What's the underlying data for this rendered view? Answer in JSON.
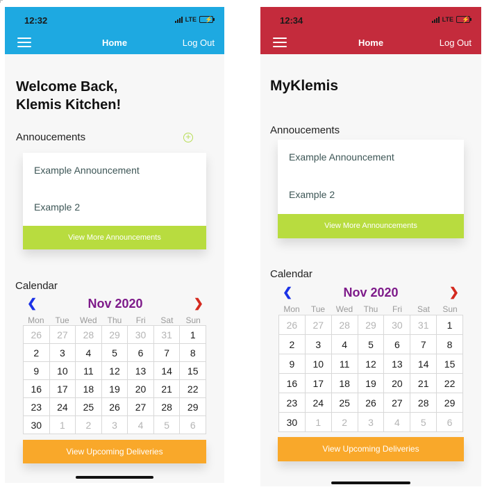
{
  "left_screen": {
    "status": {
      "time": "12:32",
      "network": "LTE"
    },
    "header": {
      "title": "Home",
      "logout": "Log Out",
      "color": "#1ea9e1"
    },
    "welcome_line1": "Welcome Back,",
    "welcome_line2": "Klemis Kitchen!",
    "announcements": {
      "label": "Annoucements",
      "items": [
        "Example Announcement",
        "Example 2"
      ],
      "button": "View More Announcements"
    },
    "calendar": {
      "label": "Calendar",
      "month": "Nov 2020",
      "prev": "❮",
      "next": "❯",
      "weekdays": [
        "Mon",
        "Tue",
        "Wed",
        "Thu",
        "Fri",
        "Sat",
        "Sun"
      ],
      "days": [
        {
          "d": "26",
          "m": true
        },
        {
          "d": "27",
          "m": true
        },
        {
          "d": "28",
          "m": true
        },
        {
          "d": "29",
          "m": true
        },
        {
          "d": "30",
          "m": true
        },
        {
          "d": "31",
          "m": true
        },
        {
          "d": "1",
          "m": false
        },
        {
          "d": "2",
          "m": false
        },
        {
          "d": "3",
          "m": false
        },
        {
          "d": "4",
          "m": false
        },
        {
          "d": "5",
          "m": false
        },
        {
          "d": "6",
          "m": false
        },
        {
          "d": "7",
          "m": false
        },
        {
          "d": "8",
          "m": false
        },
        {
          "d": "9",
          "m": false
        },
        {
          "d": "10",
          "m": false
        },
        {
          "d": "11",
          "m": false
        },
        {
          "d": "12",
          "m": false
        },
        {
          "d": "13",
          "m": false
        },
        {
          "d": "14",
          "m": false
        },
        {
          "d": "15",
          "m": false
        },
        {
          "d": "16",
          "m": false
        },
        {
          "d": "17",
          "m": false
        },
        {
          "d": "18",
          "m": false
        },
        {
          "d": "19",
          "m": false
        },
        {
          "d": "20",
          "m": false
        },
        {
          "d": "21",
          "m": false
        },
        {
          "d": "22",
          "m": false
        },
        {
          "d": "23",
          "m": false
        },
        {
          "d": "24",
          "m": false
        },
        {
          "d": "25",
          "m": false
        },
        {
          "d": "26",
          "m": false
        },
        {
          "d": "27",
          "m": false
        },
        {
          "d": "28",
          "m": false
        },
        {
          "d": "29",
          "m": false
        },
        {
          "d": "30",
          "m": false
        },
        {
          "d": "1",
          "m": true
        },
        {
          "d": "2",
          "m": true
        },
        {
          "d": "3",
          "m": true
        },
        {
          "d": "4",
          "m": true
        },
        {
          "d": "5",
          "m": true
        },
        {
          "d": "6",
          "m": true
        }
      ]
    },
    "deliveries_button": "View Upcoming Deliveries"
  },
  "right_screen": {
    "status": {
      "time": "12:34",
      "network": "LTE"
    },
    "header": {
      "title": "Home",
      "logout": "Log Out",
      "color": "#c42b3c"
    },
    "brand_title": "MyKlemis",
    "announcements": {
      "label": "Annoucements",
      "items": [
        "Example Announcement",
        "Example 2"
      ],
      "button": "View More Announcements"
    },
    "calendar": {
      "label": "Calendar",
      "month": "Nov 2020",
      "prev": "❮",
      "next": "❯",
      "weekdays": [
        "Mon",
        "Tue",
        "Wed",
        "Thu",
        "Fri",
        "Sat",
        "Sun"
      ],
      "days": [
        {
          "d": "26",
          "m": true
        },
        {
          "d": "27",
          "m": true
        },
        {
          "d": "28",
          "m": true
        },
        {
          "d": "29",
          "m": true
        },
        {
          "d": "30",
          "m": true
        },
        {
          "d": "31",
          "m": true
        },
        {
          "d": "1",
          "m": false
        },
        {
          "d": "2",
          "m": false
        },
        {
          "d": "3",
          "m": false
        },
        {
          "d": "4",
          "m": false
        },
        {
          "d": "5",
          "m": false
        },
        {
          "d": "6",
          "m": false
        },
        {
          "d": "7",
          "m": false
        },
        {
          "d": "8",
          "m": false
        },
        {
          "d": "9",
          "m": false
        },
        {
          "d": "10",
          "m": false
        },
        {
          "d": "11",
          "m": false
        },
        {
          "d": "12",
          "m": false
        },
        {
          "d": "13",
          "m": false
        },
        {
          "d": "14",
          "m": false
        },
        {
          "d": "15",
          "m": false
        },
        {
          "d": "16",
          "m": false
        },
        {
          "d": "17",
          "m": false
        },
        {
          "d": "18",
          "m": false
        },
        {
          "d": "19",
          "m": false
        },
        {
          "d": "20",
          "m": false
        },
        {
          "d": "21",
          "m": false
        },
        {
          "d": "22",
          "m": false
        },
        {
          "d": "23",
          "m": false
        },
        {
          "d": "24",
          "m": false
        },
        {
          "d": "25",
          "m": false
        },
        {
          "d": "26",
          "m": false
        },
        {
          "d": "27",
          "m": false
        },
        {
          "d": "28",
          "m": false
        },
        {
          "d": "29",
          "m": false
        },
        {
          "d": "30",
          "m": false
        },
        {
          "d": "1",
          "m": true
        },
        {
          "d": "2",
          "m": true
        },
        {
          "d": "3",
          "m": true
        },
        {
          "d": "4",
          "m": true
        },
        {
          "d": "5",
          "m": true
        },
        {
          "d": "6",
          "m": true
        }
      ]
    },
    "deliveries_button": "View Upcoming Deliveries"
  },
  "colors": {
    "announcement_button": "#b8dc3f",
    "deliveries_button": "#f9a82a",
    "month_label": "#7e1b8a",
    "prev_arrow": "#1b32e6",
    "next_arrow": "#d42a1f"
  },
  "icons": {
    "menu": "menu-icon",
    "add": "add-circle-icon",
    "signal": "signal-icon",
    "battery": "battery-charging-icon"
  }
}
